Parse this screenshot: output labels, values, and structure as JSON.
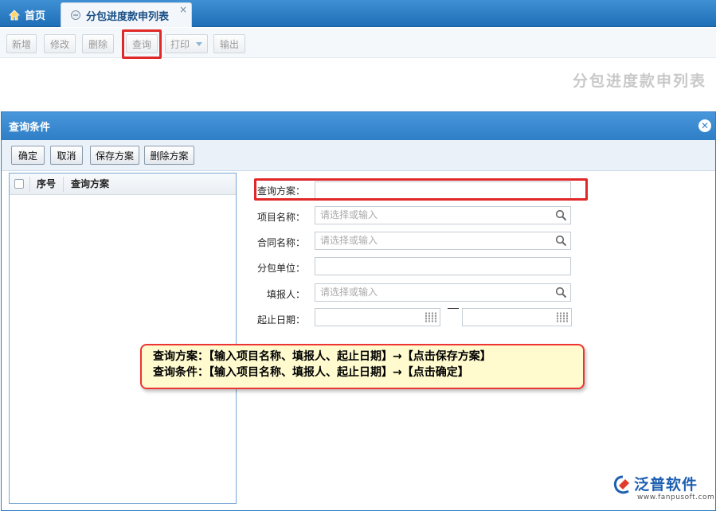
{
  "tabs": [
    {
      "label": "首页",
      "icon": "home-icon"
    },
    {
      "label": "分包进度款申列表",
      "icon": "page-icon",
      "close": "×"
    }
  ],
  "toolbar": {
    "buttons": [
      "新增",
      "修改",
      "删除",
      "查询",
      "打印",
      "输出"
    ]
  },
  "page_heading": "分包进度款申列表",
  "dialog": {
    "title": "查询条件",
    "close": "✕",
    "buttons": [
      "确定",
      "取消",
      "保存方案",
      "删除方案"
    ],
    "list": {
      "columns": [
        "序号",
        "查询方案"
      ]
    },
    "form": [
      {
        "label": "查询方案：",
        "value": "",
        "placeholder": ""
      },
      {
        "label": "项目名称：",
        "value": "",
        "placeholder": "请选择或输入",
        "icon": "search-icon"
      },
      {
        "label": "合同名称：",
        "value": "",
        "placeholder": "请选择或输入",
        "icon": "search-icon"
      },
      {
        "label": "分包单位：",
        "value": "",
        "placeholder": ""
      },
      {
        "label": "填报人：",
        "value": "",
        "placeholder": "请选择或输入",
        "icon": "search-icon"
      },
      {
        "label": "起止日期：",
        "value": "",
        "placeholder": "",
        "icon": "calendar-icon"
      }
    ]
  },
  "callout": {
    "lines": [
      "查询方案：【输入项目名称、填报人、起止日期】→【点击保存方案】",
      "查询条件：【输入项目名称、填报人、起止日期】→【点击确定】"
    ]
  },
  "brand": {
    "name": "泛普软件",
    "url": "www.fanpusoft.com"
  },
  "colors": {
    "tabbar": "#2a7fc8",
    "highlight": "#e02828",
    "callout_bg": "#fffbcf"
  }
}
